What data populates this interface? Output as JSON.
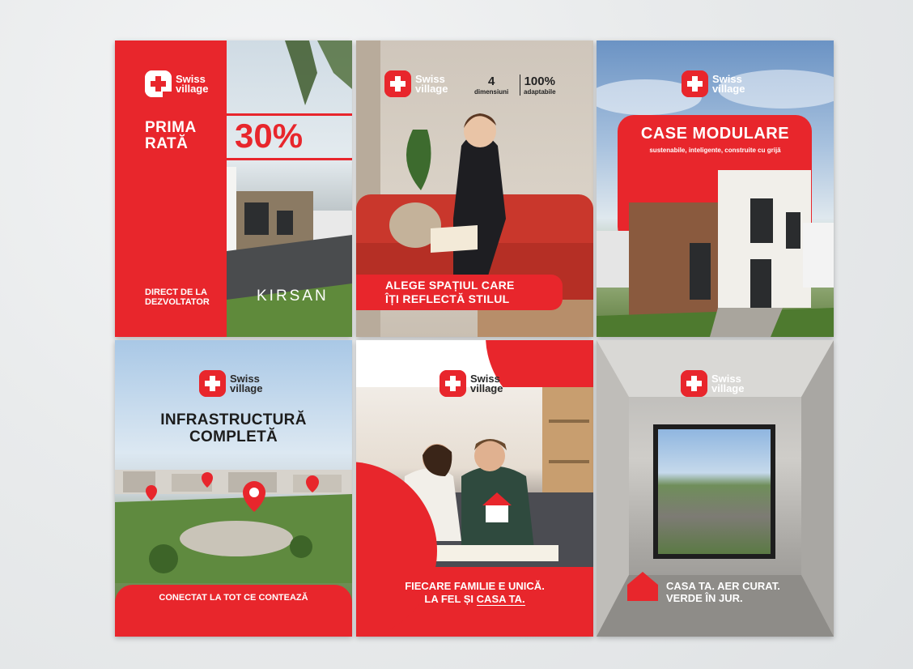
{
  "brand": {
    "name_line1": "Swiss",
    "name_line2": "village",
    "red": "#e8262c"
  },
  "tile1": {
    "headline_line1": "PRIMA",
    "headline_line2": "RATĂ",
    "percent": "30%",
    "direct_line1": "DIRECT DE LA",
    "direct_line2": "DEZVOLTATOR",
    "partner": "KIRSAN"
  },
  "tile2": {
    "spec1_big": "4",
    "spec1_small": "dimensiuni",
    "spec2_big": "100%",
    "spec2_small": "adaptabile",
    "banner_line1": "ALEGE SPAȚIUL CARE",
    "banner_line2": "ÎȚI REFLECTĂ STILUL"
  },
  "tile3": {
    "title": "CASE MODULARE",
    "subtitle": "sustenabile, inteligente, construite cu grijă"
  },
  "tile4": {
    "title_line1": "INFRASTRUCTURĂ",
    "title_line2": "COMPLETĂ",
    "bottom": "CONECTAT LA TOT CE CONTEAZĂ"
  },
  "tile5": {
    "line1": "FIECARE FAMILIE E UNICĂ.",
    "line2_prefix": "LA FEL ȘI ",
    "line2_underlined": "CASA TA."
  },
  "tile6": {
    "line1": "CASA TA. AER CURAT.",
    "line2": "VERDE ÎN JUR."
  }
}
